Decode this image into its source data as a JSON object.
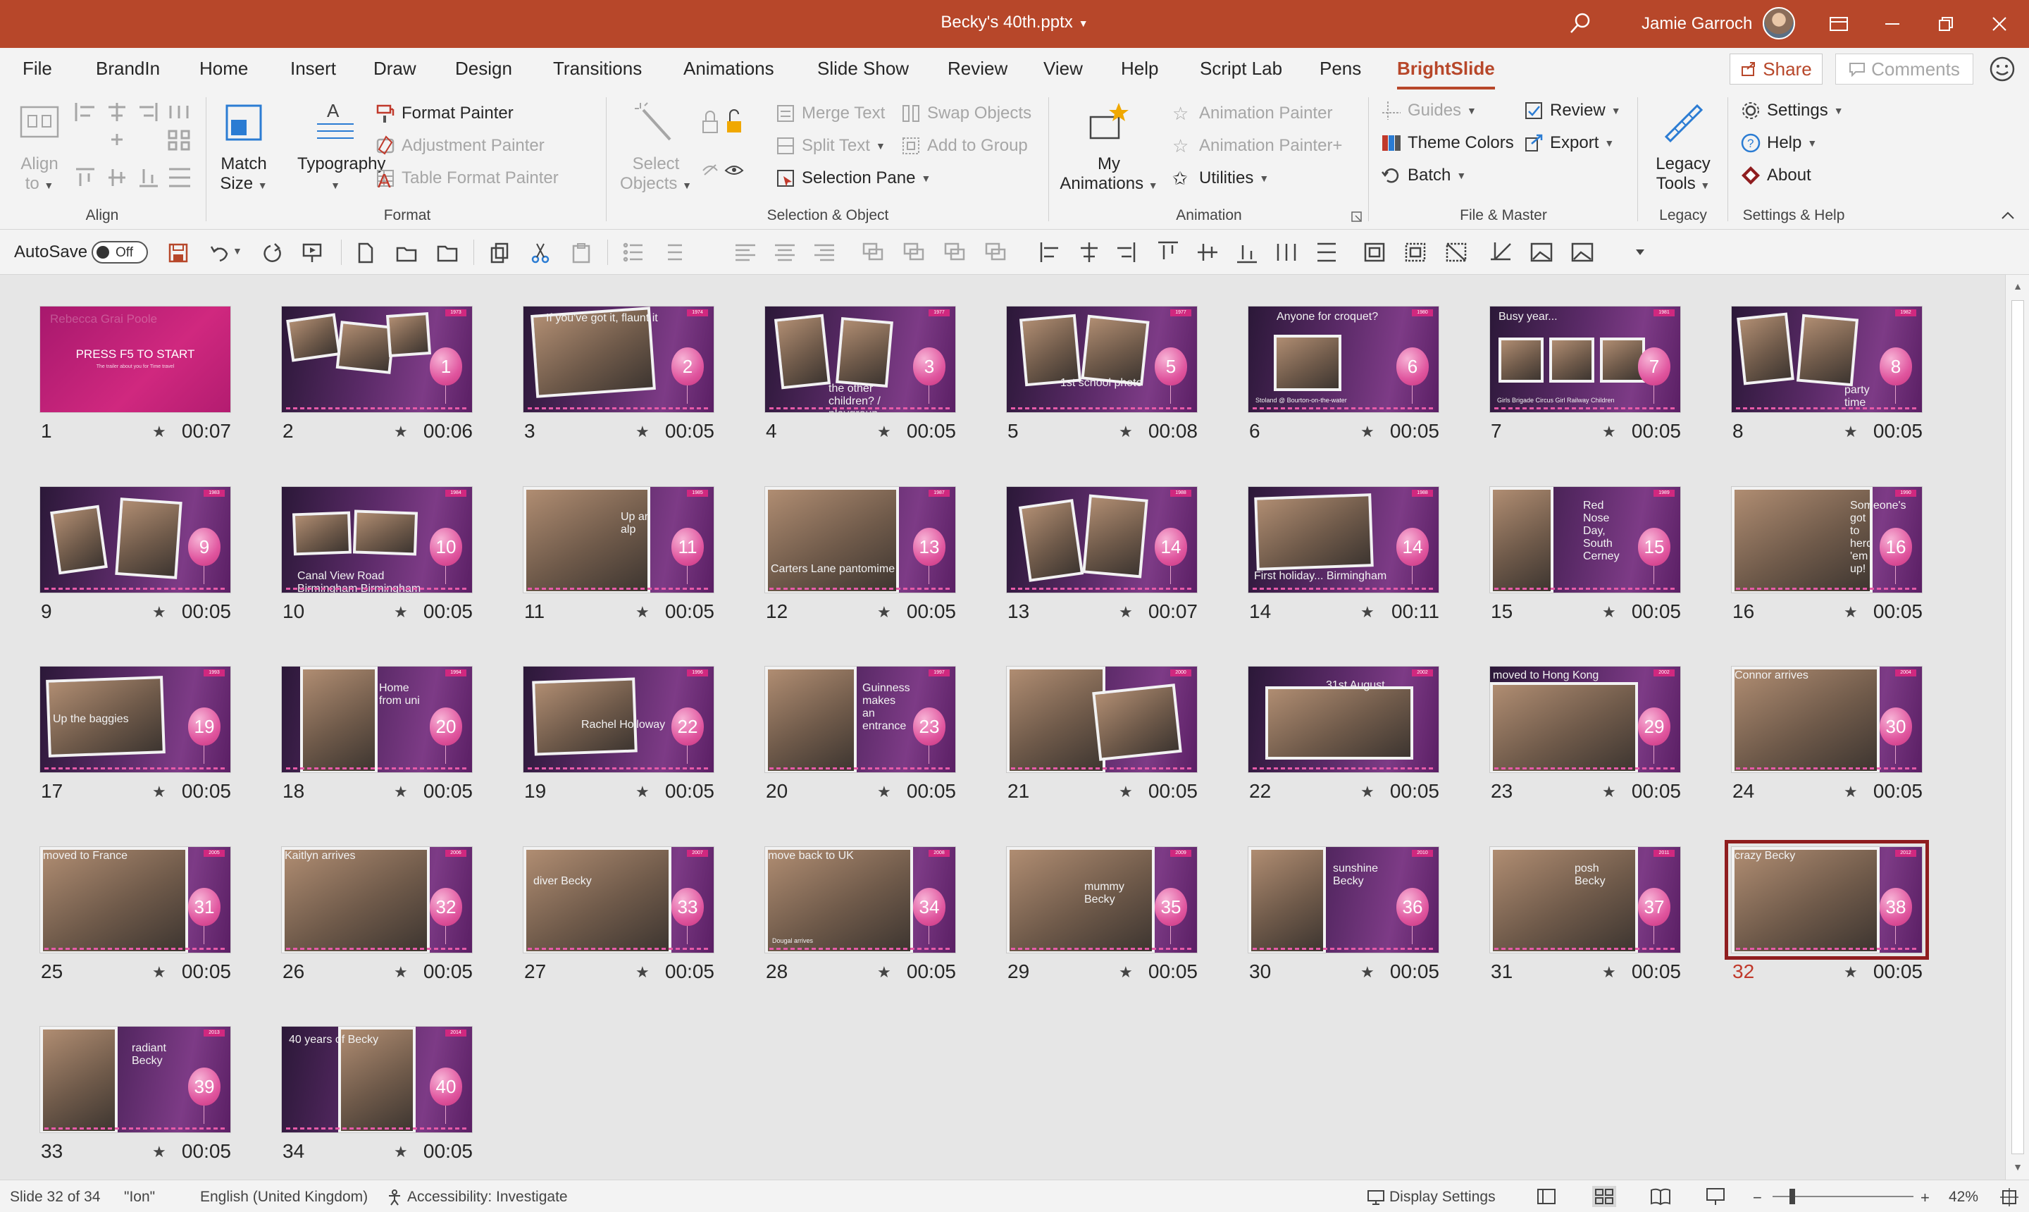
{
  "window": {
    "title": "Becky's 40th.pptx",
    "user": "Jamie Garroch",
    "colors": {
      "accent": "#b7472a",
      "selection": "#8f1d1f"
    }
  },
  "menu": {
    "tabs": [
      "File",
      "BrandIn",
      "Home",
      "Insert",
      "Draw",
      "Design",
      "Transitions",
      "Animations",
      "Slide Show",
      "Review",
      "View",
      "Help",
      "Script Lab",
      "Pens",
      "BrightSlide"
    ],
    "active": "BrightSlide",
    "share": "Share",
    "comments": "Comments"
  },
  "ribbon": {
    "align": {
      "align_to": "Align",
      "align_to2": "to",
      "label": "Align"
    },
    "format": {
      "match_size": "Match",
      "match_size2": "Size",
      "typography": "Typography",
      "format_painter": "Format Painter",
      "adjustment_painter": "Adjustment Painter",
      "table_format_painter": "Table Format Painter",
      "label": "Format"
    },
    "selection": {
      "select_objects": "Select",
      "select_objects2": "Objects",
      "merge_text": "Merge Text",
      "split_text": "Split Text",
      "swap_objects": "Swap Objects",
      "add_to_group": "Add to Group",
      "selection_pane": "Selection Pane",
      "label": "Selection & Object"
    },
    "animation": {
      "my_animations": "My",
      "my_animations2": "Animations",
      "animation_painter": "Animation Painter",
      "animation_painter_plus": "Animation Painter+",
      "utilities": "Utilities",
      "label": "Animation"
    },
    "file_master": {
      "guides": "Guides",
      "theme_colors": "Theme Colors",
      "batch": "Batch",
      "review": "Review",
      "export": "Export",
      "label": "File & Master"
    },
    "legacy": {
      "legacy_tools": "Legacy",
      "legacy_tools2": "Tools",
      "label": "Legacy"
    },
    "settings": {
      "settings": "Settings",
      "help": "Help",
      "about": "About",
      "label": "Settings & Help"
    }
  },
  "qat": {
    "autosave": "AutoSave",
    "autosave_state": "Off"
  },
  "slides": [
    {
      "num": "1",
      "time": "00:07",
      "caption": "PRESS F5 TO START",
      "faint": "Rebecca Grai Poole",
      "tiny": "The trailer about you for Time travel",
      "balloon": ""
    },
    {
      "num": "2",
      "time": "00:06",
      "caption": "",
      "balloon": "1",
      "year": "1973"
    },
    {
      "num": "3",
      "time": "00:05",
      "caption": "If you've got it, flaunt it",
      "balloon": "2",
      "year": "1974"
    },
    {
      "num": "4",
      "time": "00:05",
      "caption": "the other children? / playgroup",
      "balloon": "3",
      "year": "1977"
    },
    {
      "num": "5",
      "time": "00:08",
      "caption": "1st school photo",
      "balloon": "5",
      "year": "1977"
    },
    {
      "num": "6",
      "time": "00:05",
      "caption": "Anyone for croquet?",
      "sub": "Stoland @ Bourton-on-the-water",
      "balloon": "6",
      "year": "1980"
    },
    {
      "num": "7",
      "time": "00:05",
      "caption": "Busy year...",
      "sub": "Girls Brigade   Circus Girl   Railway Children",
      "balloon": "7",
      "year": "1981"
    },
    {
      "num": "8",
      "time": "00:05",
      "caption": "party time",
      "balloon": "8",
      "year": "1982"
    },
    {
      "num": "9",
      "time": "00:05",
      "caption": "",
      "balloon": "9",
      "year": "1983"
    },
    {
      "num": "10",
      "time": "00:05",
      "caption": "Canal View Road Birmingham   Birmingham Institution",
      "balloon": "10",
      "year": "1984"
    },
    {
      "num": "11",
      "time": "00:05",
      "caption": "Up an alp",
      "balloon": "11",
      "year": "1985"
    },
    {
      "num": "12",
      "time": "00:05",
      "caption": "Carters Lane pantomime",
      "balloon": "13",
      "year": "1987"
    },
    {
      "num": "13",
      "time": "00:07",
      "caption": "",
      "balloon": "14",
      "year": "1988"
    },
    {
      "num": "14",
      "time": "00:11",
      "caption": "First holiday... Birmingham",
      "balloon": "14",
      "year": "1988"
    },
    {
      "num": "15",
      "time": "00:05",
      "caption": "Red Nose Day, South Cerney",
      "balloon": "15",
      "year": "1989"
    },
    {
      "num": "16",
      "time": "00:05",
      "caption": "Someone's got to herd 'em up!",
      "balloon": "16",
      "year": "1990"
    },
    {
      "num": "17",
      "time": "00:05",
      "caption": "Up the baggies",
      "balloon": "19",
      "year": "1993"
    },
    {
      "num": "18",
      "time": "00:05",
      "caption": "Home from uni",
      "balloon": "20",
      "year": "1994"
    },
    {
      "num": "19",
      "time": "00:05",
      "caption": "Rachel Holloway",
      "balloon": "22",
      "year": "1996"
    },
    {
      "num": "20",
      "time": "00:05",
      "caption": "Guinness makes an entrance",
      "balloon": "23",
      "year": "1997"
    },
    {
      "num": "21",
      "time": "00:05",
      "caption": "",
      "balloon": "",
      "year": "2000"
    },
    {
      "num": "22",
      "time": "00:05",
      "caption": "31st August",
      "balloon": "",
      "year": "2002"
    },
    {
      "num": "23",
      "time": "00:05",
      "caption": "moved to Hong Kong",
      "balloon": "29",
      "year": "2002"
    },
    {
      "num": "24",
      "time": "00:05",
      "caption": "Connor arrives",
      "balloon": "30",
      "year": "2004"
    },
    {
      "num": "25",
      "time": "00:05",
      "caption": "moved to France",
      "balloon": "31",
      "year": "2005"
    },
    {
      "num": "26",
      "time": "00:05",
      "caption": "Kaitlyn arrives",
      "balloon": "32",
      "year": "2006"
    },
    {
      "num": "27",
      "time": "00:05",
      "caption": "diver Becky",
      "balloon": "33",
      "year": "2007"
    },
    {
      "num": "28",
      "time": "00:05",
      "caption": "move back to UK",
      "sub": "Dougal arrives",
      "balloon": "34",
      "year": "2008"
    },
    {
      "num": "29",
      "time": "00:05",
      "caption": "mummy Becky",
      "balloon": "35",
      "year": "2009"
    },
    {
      "num": "30",
      "time": "00:05",
      "caption": "sunshine Becky",
      "balloon": "36",
      "year": "2010"
    },
    {
      "num": "31",
      "time": "00:05",
      "caption": "posh Becky",
      "balloon": "37",
      "year": "2011"
    },
    {
      "num": "32",
      "time": "00:05",
      "caption": "crazy Becky",
      "balloon": "38",
      "year": "2012",
      "selected": true
    },
    {
      "num": "33",
      "time": "00:05",
      "caption": "radiant Becky",
      "balloon": "39",
      "year": "2013"
    },
    {
      "num": "34",
      "time": "00:05",
      "caption": "40 years of Becky",
      "balloon": "40",
      "year": "2014"
    }
  ],
  "status": {
    "slide_of": "Slide 32 of 34",
    "theme": "\"Ion\"",
    "language": "English (United Kingdom)",
    "accessibility": "Accessibility: Investigate",
    "display_settings": "Display Settings",
    "zoom_minus": "−",
    "zoom_plus": "+",
    "zoom": "42%"
  }
}
